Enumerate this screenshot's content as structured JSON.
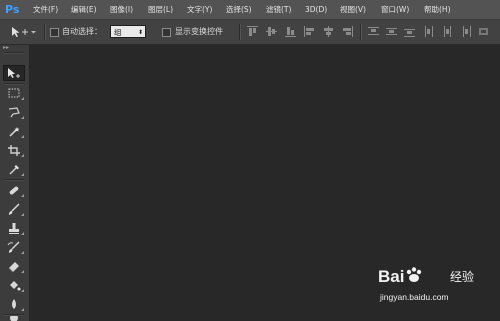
{
  "app": {
    "logo": "Ps",
    "logo_color": "#3fa0ff"
  },
  "menu": [
    {
      "label": "文件(F)"
    },
    {
      "label": "编辑(E)"
    },
    {
      "label": "图像(I)"
    },
    {
      "label": "图层(L)"
    },
    {
      "label": "文字(Y)"
    },
    {
      "label": "选择(S)"
    },
    {
      "label": "滤镜(T)"
    },
    {
      "label": "3D(D)"
    },
    {
      "label": "视图(V)"
    },
    {
      "label": "窗口(W)"
    },
    {
      "label": "帮助(H)"
    }
  ],
  "options": {
    "tool_preset_icon": "move-tool-icon",
    "auto_select_label": "自动选择：",
    "auto_select_checked": false,
    "auto_select_value": "组",
    "show_transform_label": "显示变换控件",
    "show_transform_checked": false
  },
  "tools": [
    {
      "name": "move-tool-icon"
    },
    {
      "name": "rect-marquee-icon"
    },
    {
      "name": "lasso-icon"
    },
    {
      "name": "quick-select-icon"
    },
    {
      "name": "crop-icon"
    },
    {
      "name": "eyedropper-icon"
    },
    {
      "name": "healing-brush-icon"
    },
    {
      "name": "brush-icon"
    },
    {
      "name": "clone-stamp-icon"
    },
    {
      "name": "history-brush-icon"
    },
    {
      "name": "eraser-icon"
    },
    {
      "name": "paint-bucket-icon"
    },
    {
      "name": "blur-icon"
    },
    {
      "name": "dodge-icon"
    }
  ],
  "watermark": {
    "brand": "Bai",
    "brand_suffix": "经验",
    "url": "jingyan.baidu.com"
  }
}
